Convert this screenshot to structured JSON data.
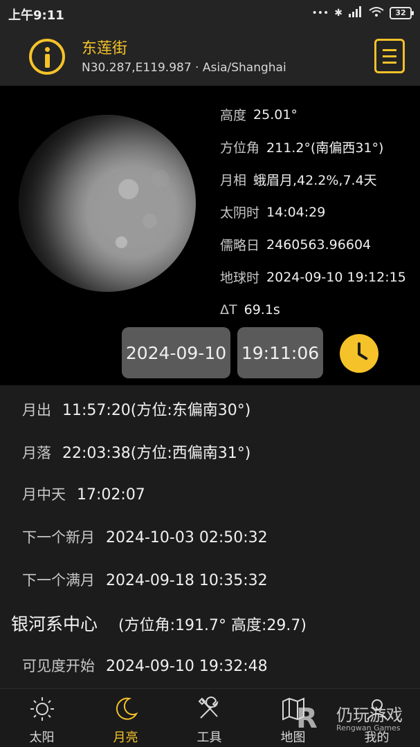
{
  "status_bar": {
    "time": "上午9:11",
    "icons_text": "... ✱ HD ",
    "battery": "32"
  },
  "header": {
    "location_name": "东莲街",
    "coords": "N30.287,E119.987 · Asia/Shanghai",
    "accent_color": "#f5c22a"
  },
  "moon": {
    "info": [
      {
        "label": "高度",
        "value": "25.01°"
      },
      {
        "label": "方位角",
        "value": "211.2°(南偏西31°)"
      },
      {
        "label": "月相",
        "value": "蛾眉月,42.2%,7.4天"
      },
      {
        "label": "太阴时",
        "value": "14:04:29"
      },
      {
        "label": "儒略日",
        "value": "2460563.96604"
      },
      {
        "label": "地球时",
        "value": "2024-09-10 19:12:15"
      },
      {
        "label": "ΔT",
        "value": "69.1s"
      }
    ],
    "date": "2024-09-10",
    "time": "19:11:06"
  },
  "events": {
    "rise": {
      "label": "月出",
      "value": "11:57:20(方位:东偏南30°)"
    },
    "set": {
      "label": "月落",
      "value": "22:03:38(方位:西偏南31°)"
    },
    "transit": {
      "label": "月中天",
      "value": "17:02:07"
    },
    "new_moon": {
      "label": "下一个新月",
      "value": "2024-10-03 02:50:32"
    },
    "full_moon": {
      "label": "下一个满月",
      "value": "2024-09-18 10:35:32"
    },
    "galaxy": {
      "label": "银河系中心",
      "value": "(方位角:191.7° 高度:29.7)"
    },
    "visibility": {
      "label": "可见度开始",
      "value": "2024-09-10 19:32:48"
    }
  },
  "nav": {
    "sun": "太阳",
    "moon": "月亮",
    "tools": "工具",
    "map": "地图",
    "mine": "我的"
  },
  "watermark": {
    "cn": "仍玩游戏",
    "en": "Rengwan Games"
  }
}
